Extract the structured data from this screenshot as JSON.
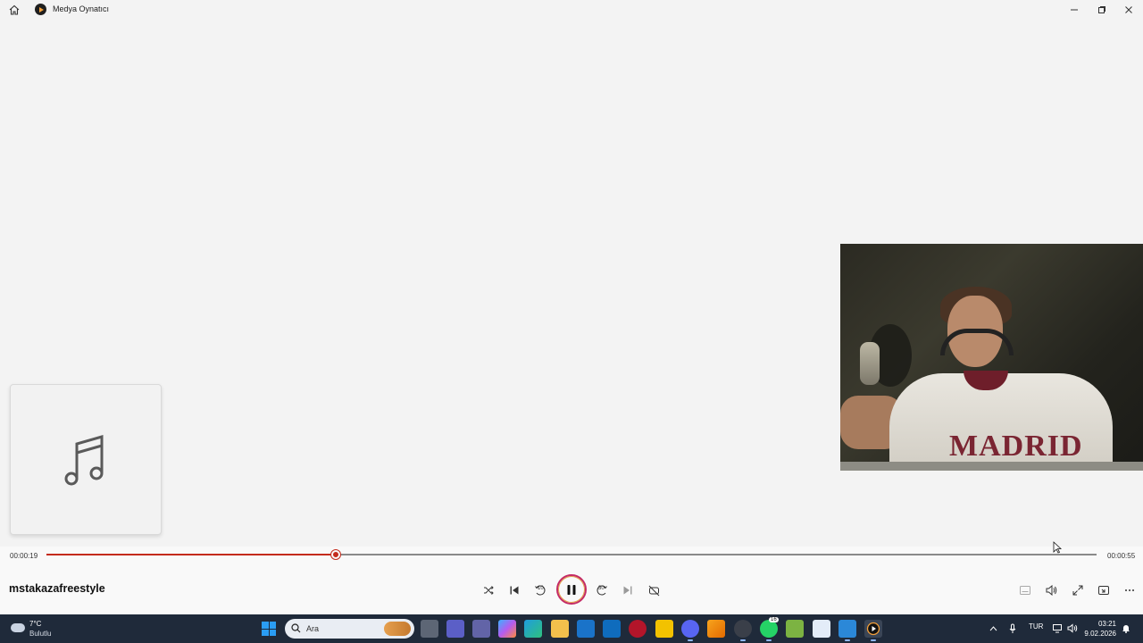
{
  "window": {
    "title": "Medya Oynatıcı",
    "controls": [
      "minimize",
      "restore",
      "close"
    ]
  },
  "player": {
    "elapsed": "00:00:19",
    "duration": "00:00:55",
    "progress": 0.2755,
    "song_title": "mstakazafreestyle",
    "state": "playing",
    "accent_color": "#c42b1c",
    "video_text": "MADRID",
    "buttons": [
      "shuffle-icon",
      "previous-icon",
      "rewind-10-icon",
      "pause-icon",
      "forward-30-icon",
      "next-icon",
      "repeat-icon",
      "subtitles-icon",
      "volume-icon",
      "fullscreen-icon",
      "miniplayer-icon",
      "more-icon"
    ],
    "skip_back_label": "10",
    "skip_forward_label": "30"
  },
  "taskbar": {
    "weather_temp": "7°C",
    "weather_desc": "Bulutlu",
    "search_placeholder": "Ara",
    "language": "TUR",
    "time": "03:21",
    "date": "9.02.2026",
    "whatsapp_badge": "16"
  }
}
